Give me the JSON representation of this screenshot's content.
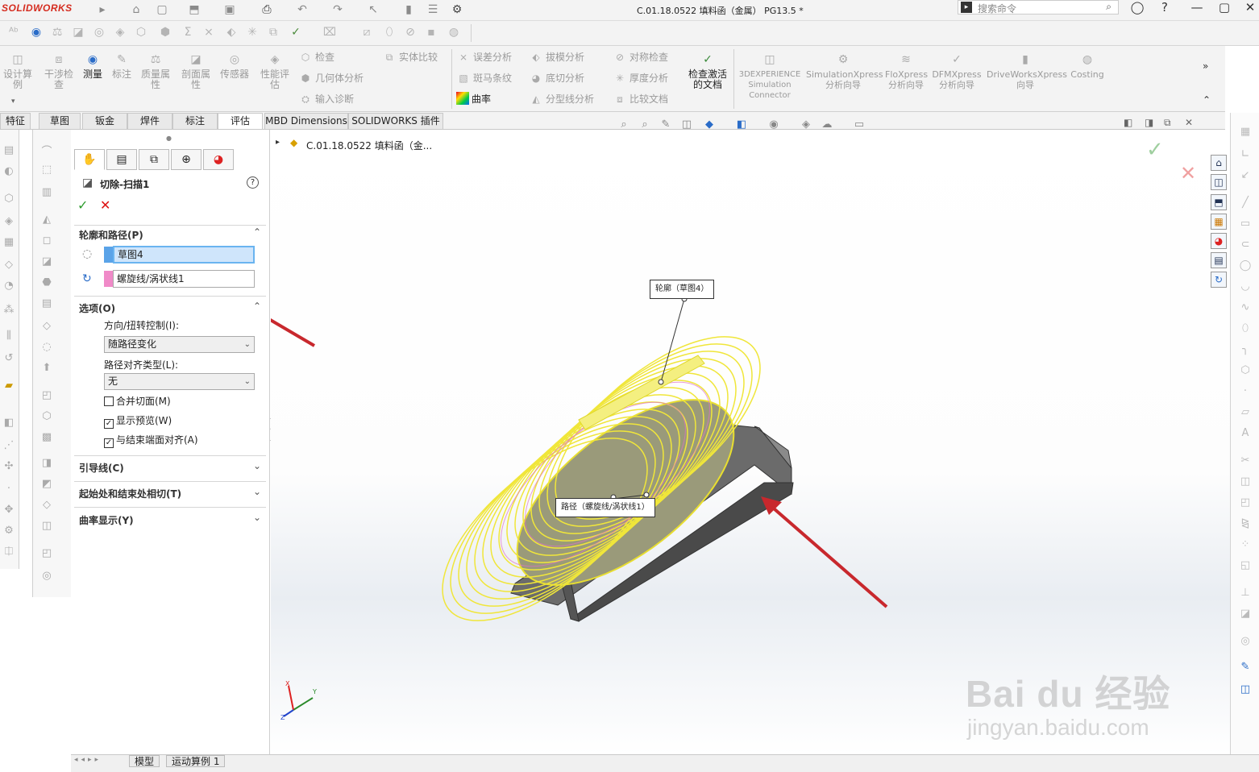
{
  "app": {
    "logo": "SOLIDWORKS",
    "title": "C.01.18.0522 填料函（金属） PG13.5 *",
    "search_placeholder": "搜索命令"
  },
  "command_manager": {
    "large": [
      "设计算例",
      "干涉检查",
      "测量",
      "标注",
      "质量属性",
      "剖面属性",
      "传感器",
      "性能评估",
      "检查激活的文档",
      "3DEXPERIENCE Simulation Connector",
      "SimulationXpress 分析向导",
      "FloXpress 分析向导",
      "DFMXpress 分析向导",
      "DriveWorksXpress 向导",
      "Costing"
    ],
    "small": [
      "检查",
      "几何体分析",
      "输入诊断",
      "实体比较",
      "误差分析",
      "斑马条纹",
      "曲率",
      "拔模分析",
      "底切分析",
      "分型线分析",
      "对称检查",
      "厚度分析",
      "比较文档"
    ]
  },
  "tabs": [
    "特征",
    "草图",
    "钣金",
    "焊件",
    "标注",
    "评估",
    "MBD Dimensions",
    "SOLIDWORKS 插件"
  ],
  "active_tab": "评估",
  "property_manager": {
    "title": "切除-扫描1",
    "sections": {
      "profile_path": {
        "label": "轮廓和路径(P)",
        "profile": "草图4",
        "path": "螺旋线/涡状线1"
      },
      "options": {
        "label": "选项(O)",
        "orientation_label": "方向/扭转控制(I):",
        "orientation_value": "随路径变化",
        "align_label": "路径对齐类型(L):",
        "align_value": "无",
        "merge_faces": "合并切面(M)",
        "show_preview": "显示预览(W)",
        "align_end": "与结束端面对齐(A)"
      },
      "guides": "引导线(C)",
      "tangency": "起始处和结束处相切(T)",
      "curvature": "曲率显示(Y)"
    },
    "checks": {
      "merge_faces": false,
      "show_preview": true,
      "align_end": true
    }
  },
  "tree": {
    "root": "C.01.18.0522 填料函（金..."
  },
  "callouts": {
    "profile": "轮廓（草图4）",
    "path": "路径（螺旋线/涡状线1）"
  },
  "status": {
    "model_tab": "模型",
    "motion_tab": "运动算例 1"
  },
  "watermark": {
    "brand": "Bai du 经验",
    "url": "jingyan.baidu.com"
  },
  "colors": {
    "helix": "#f0e63a",
    "profile_swatch": "#5aa3e8",
    "path_swatch": "#f08ac8",
    "arrow": "#c8282d",
    "confirm": "#2e9c2e",
    "cancel": "#d11"
  }
}
